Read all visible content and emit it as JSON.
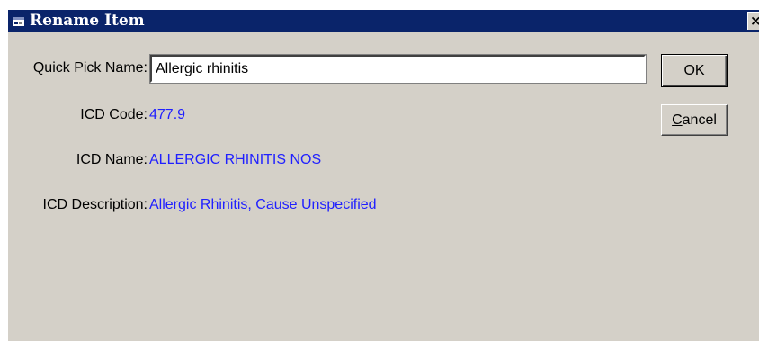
{
  "dialog": {
    "title": "Rename Item",
    "close_symbol": "×"
  },
  "fields": {
    "quick_pick_label": "Quick Pick Name:",
    "quick_pick_value": "Allergic rhinitis",
    "icd_code_label": "ICD Code:",
    "icd_code_value": "477.9",
    "icd_name_label": "ICD Name:",
    "icd_name_value": "ALLERGIC RHINITIS NOS",
    "icd_description_label": "ICD Description:",
    "icd_description_value": "Allergic Rhinitis, Cause Unspecified"
  },
  "buttons": {
    "ok_mnemonic": "O",
    "ok_rest": "K",
    "cancel_mnemonic": "C",
    "cancel_rest": "ancel"
  },
  "icons": {
    "app": "app-window-icon",
    "close": "close-icon"
  },
  "colors": {
    "titlebar": "#0a246a",
    "dialog_bg": "#d4d0c8",
    "value_text": "#2020ff"
  }
}
